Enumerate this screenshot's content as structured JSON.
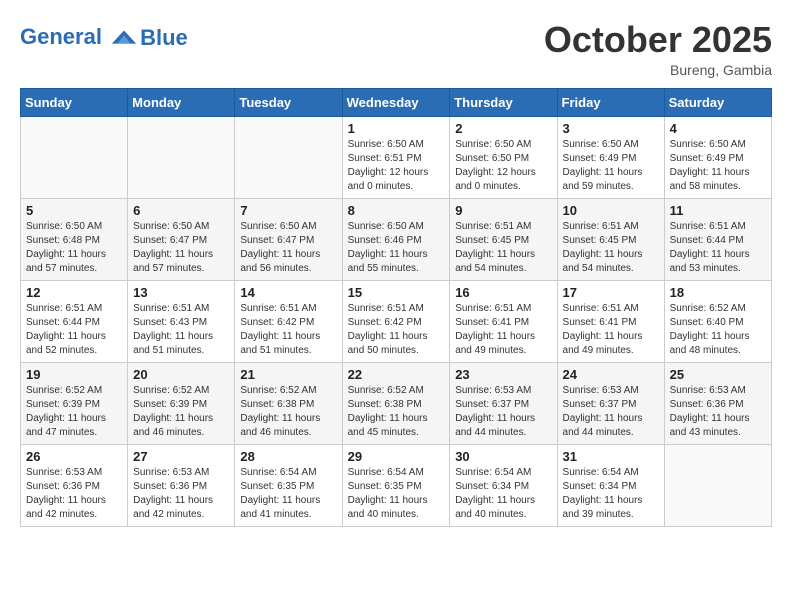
{
  "header": {
    "logo_line1": "General",
    "logo_line2": "Blue",
    "month": "October 2025",
    "location": "Bureng, Gambia"
  },
  "weekdays": [
    "Sunday",
    "Monday",
    "Tuesday",
    "Wednesday",
    "Thursday",
    "Friday",
    "Saturday"
  ],
  "weeks": [
    [
      {
        "day": "",
        "info": ""
      },
      {
        "day": "",
        "info": ""
      },
      {
        "day": "",
        "info": ""
      },
      {
        "day": "1",
        "info": "Sunrise: 6:50 AM\nSunset: 6:51 PM\nDaylight: 12 hours\nand 0 minutes."
      },
      {
        "day": "2",
        "info": "Sunrise: 6:50 AM\nSunset: 6:50 PM\nDaylight: 12 hours\nand 0 minutes."
      },
      {
        "day": "3",
        "info": "Sunrise: 6:50 AM\nSunset: 6:49 PM\nDaylight: 11 hours\nand 59 minutes."
      },
      {
        "day": "4",
        "info": "Sunrise: 6:50 AM\nSunset: 6:49 PM\nDaylight: 11 hours\nand 58 minutes."
      }
    ],
    [
      {
        "day": "5",
        "info": "Sunrise: 6:50 AM\nSunset: 6:48 PM\nDaylight: 11 hours\nand 57 minutes."
      },
      {
        "day": "6",
        "info": "Sunrise: 6:50 AM\nSunset: 6:47 PM\nDaylight: 11 hours\nand 57 minutes."
      },
      {
        "day": "7",
        "info": "Sunrise: 6:50 AM\nSunset: 6:47 PM\nDaylight: 11 hours\nand 56 minutes."
      },
      {
        "day": "8",
        "info": "Sunrise: 6:50 AM\nSunset: 6:46 PM\nDaylight: 11 hours\nand 55 minutes."
      },
      {
        "day": "9",
        "info": "Sunrise: 6:51 AM\nSunset: 6:45 PM\nDaylight: 11 hours\nand 54 minutes."
      },
      {
        "day": "10",
        "info": "Sunrise: 6:51 AM\nSunset: 6:45 PM\nDaylight: 11 hours\nand 54 minutes."
      },
      {
        "day": "11",
        "info": "Sunrise: 6:51 AM\nSunset: 6:44 PM\nDaylight: 11 hours\nand 53 minutes."
      }
    ],
    [
      {
        "day": "12",
        "info": "Sunrise: 6:51 AM\nSunset: 6:44 PM\nDaylight: 11 hours\nand 52 minutes."
      },
      {
        "day": "13",
        "info": "Sunrise: 6:51 AM\nSunset: 6:43 PM\nDaylight: 11 hours\nand 51 minutes."
      },
      {
        "day": "14",
        "info": "Sunrise: 6:51 AM\nSunset: 6:42 PM\nDaylight: 11 hours\nand 51 minutes."
      },
      {
        "day": "15",
        "info": "Sunrise: 6:51 AM\nSunset: 6:42 PM\nDaylight: 11 hours\nand 50 minutes."
      },
      {
        "day": "16",
        "info": "Sunrise: 6:51 AM\nSunset: 6:41 PM\nDaylight: 11 hours\nand 49 minutes."
      },
      {
        "day": "17",
        "info": "Sunrise: 6:51 AM\nSunset: 6:41 PM\nDaylight: 11 hours\nand 49 minutes."
      },
      {
        "day": "18",
        "info": "Sunrise: 6:52 AM\nSunset: 6:40 PM\nDaylight: 11 hours\nand 48 minutes."
      }
    ],
    [
      {
        "day": "19",
        "info": "Sunrise: 6:52 AM\nSunset: 6:39 PM\nDaylight: 11 hours\nand 47 minutes."
      },
      {
        "day": "20",
        "info": "Sunrise: 6:52 AM\nSunset: 6:39 PM\nDaylight: 11 hours\nand 46 minutes."
      },
      {
        "day": "21",
        "info": "Sunrise: 6:52 AM\nSunset: 6:38 PM\nDaylight: 11 hours\nand 46 minutes."
      },
      {
        "day": "22",
        "info": "Sunrise: 6:52 AM\nSunset: 6:38 PM\nDaylight: 11 hours\nand 45 minutes."
      },
      {
        "day": "23",
        "info": "Sunrise: 6:53 AM\nSunset: 6:37 PM\nDaylight: 11 hours\nand 44 minutes."
      },
      {
        "day": "24",
        "info": "Sunrise: 6:53 AM\nSunset: 6:37 PM\nDaylight: 11 hours\nand 44 minutes."
      },
      {
        "day": "25",
        "info": "Sunrise: 6:53 AM\nSunset: 6:36 PM\nDaylight: 11 hours\nand 43 minutes."
      }
    ],
    [
      {
        "day": "26",
        "info": "Sunrise: 6:53 AM\nSunset: 6:36 PM\nDaylight: 11 hours\nand 42 minutes."
      },
      {
        "day": "27",
        "info": "Sunrise: 6:53 AM\nSunset: 6:36 PM\nDaylight: 11 hours\nand 42 minutes."
      },
      {
        "day": "28",
        "info": "Sunrise: 6:54 AM\nSunset: 6:35 PM\nDaylight: 11 hours\nand 41 minutes."
      },
      {
        "day": "29",
        "info": "Sunrise: 6:54 AM\nSunset: 6:35 PM\nDaylight: 11 hours\nand 40 minutes."
      },
      {
        "day": "30",
        "info": "Sunrise: 6:54 AM\nSunset: 6:34 PM\nDaylight: 11 hours\nand 40 minutes."
      },
      {
        "day": "31",
        "info": "Sunrise: 6:54 AM\nSunset: 6:34 PM\nDaylight: 11 hours\nand 39 minutes."
      },
      {
        "day": "",
        "info": ""
      }
    ]
  ]
}
